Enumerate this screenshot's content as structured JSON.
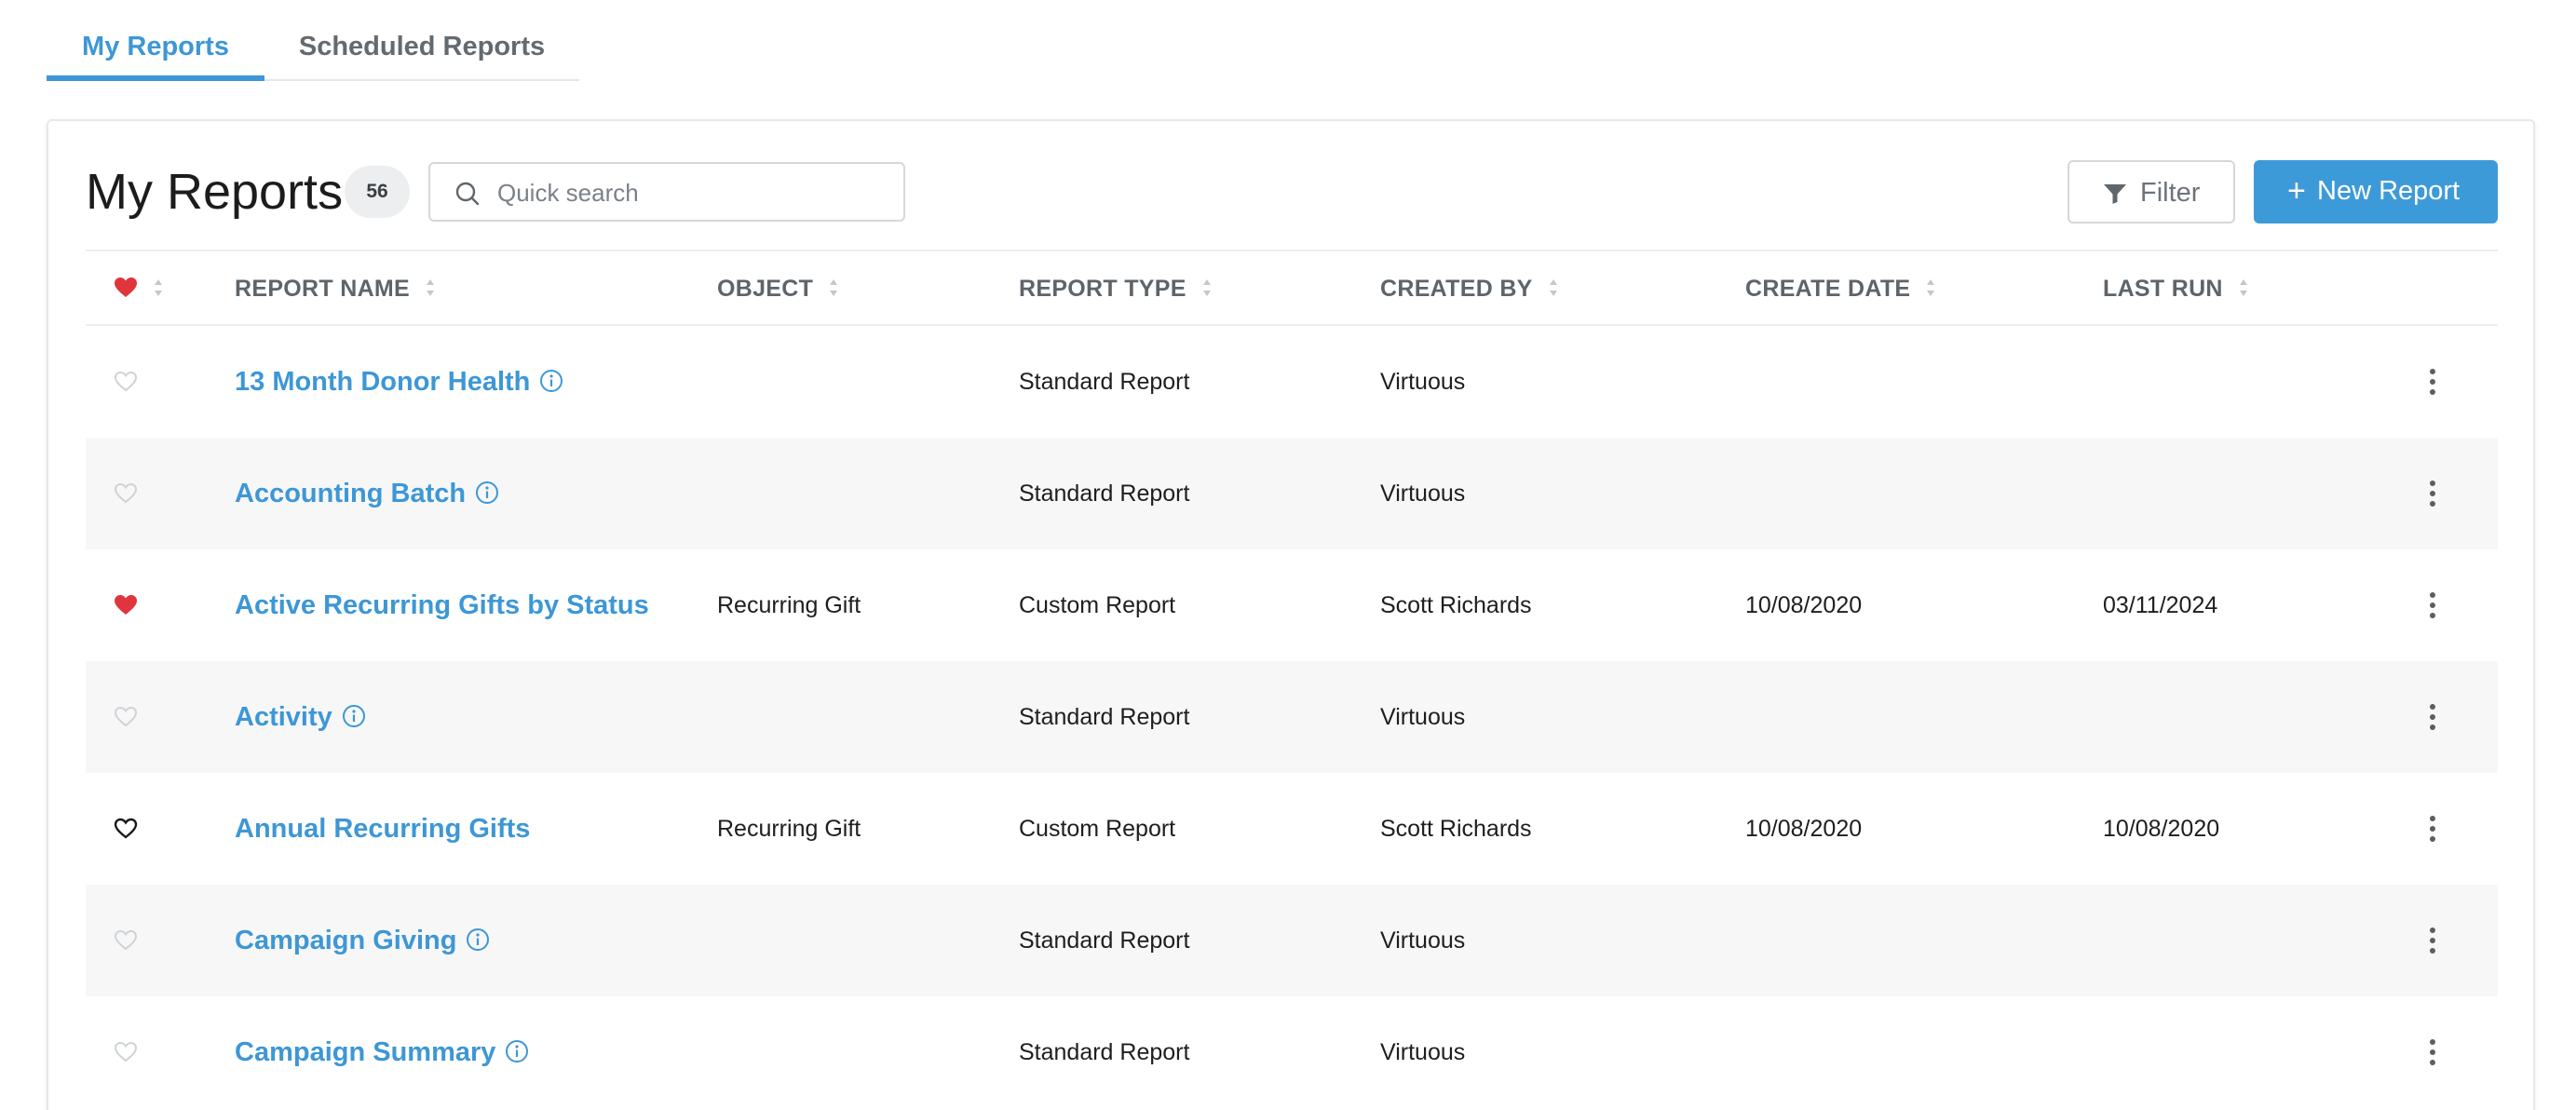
{
  "tabs": [
    {
      "label": "My Reports",
      "active": true
    },
    {
      "label": "Scheduled Reports",
      "active": false
    }
  ],
  "header": {
    "title": "My Reports",
    "count": "56",
    "search_placeholder": "Quick search",
    "filter_label": "Filter",
    "new_report_plus": "+",
    "new_report_label": "New Report"
  },
  "columns": {
    "favorite_icon": "heart-filled-icon",
    "report_name": "REPORT NAME",
    "object": "OBJECT",
    "report_type": "REPORT TYPE",
    "created_by": "CREATED BY",
    "create_date": "CREATE DATE",
    "last_run": "LAST RUN"
  },
  "colors": {
    "accent": "#3d97d6",
    "favorite_red": "#e0353d",
    "heart_outline_light": "#cfd3d6",
    "heart_outline_dark": "#1a1a1a"
  },
  "rows": [
    {
      "favorite": "empty",
      "name": "13 Month Donor Health",
      "info": true,
      "object": "",
      "type": "Standard Report",
      "created_by": "Virtuous",
      "create_date": "",
      "last_run": ""
    },
    {
      "favorite": "empty",
      "name": "Accounting Batch",
      "info": true,
      "object": "",
      "type": "Standard Report",
      "created_by": "Virtuous",
      "create_date": "",
      "last_run": ""
    },
    {
      "favorite": "filled",
      "name": "Active Recurring Gifts by Status",
      "info": false,
      "object": "Recurring Gift",
      "type": "Custom Report",
      "created_by": "Scott Richards",
      "create_date": "10/08/2020",
      "last_run": "03/11/2024"
    },
    {
      "favorite": "empty",
      "name": "Activity",
      "info": true,
      "object": "",
      "type": "Standard Report",
      "created_by": "Virtuous",
      "create_date": "",
      "last_run": ""
    },
    {
      "favorite": "outline-dark",
      "name": "Annual Recurring Gifts",
      "info": false,
      "object": "Recurring Gift",
      "type": "Custom Report",
      "created_by": "Scott Richards",
      "create_date": "10/08/2020",
      "last_run": "10/08/2020"
    },
    {
      "favorite": "empty",
      "name": "Campaign Giving",
      "info": true,
      "object": "",
      "type": "Standard Report",
      "created_by": "Virtuous",
      "create_date": "",
      "last_run": ""
    },
    {
      "favorite": "empty",
      "name": "Campaign Summary",
      "info": true,
      "object": "",
      "type": "Standard Report",
      "created_by": "Virtuous",
      "create_date": "",
      "last_run": ""
    }
  ]
}
